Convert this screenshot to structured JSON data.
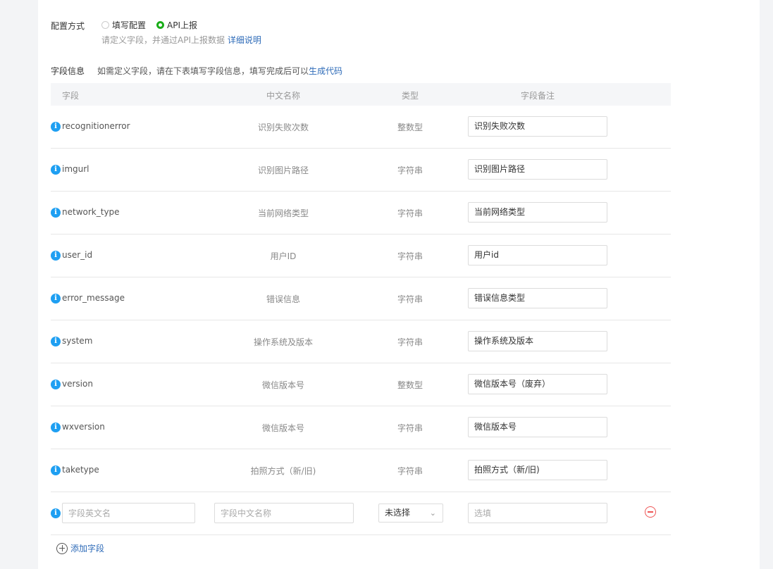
{
  "config": {
    "label": "配置方式",
    "options": [
      {
        "label": "填写配置",
        "checked": false
      },
      {
        "label": "API上报",
        "checked": true
      }
    ],
    "hint": "请定义字段，并通过API上报数据",
    "hint_link": "详细说明"
  },
  "fields": {
    "label": "字段信息",
    "hint": "如需定义字段，请在下表填写字段信息，填写完成后可以",
    "hint_link": "生成代码",
    "headers": [
      "字段",
      "中文名称",
      "类型",
      "字段备注"
    ],
    "rows": [
      {
        "key": "recognitionerror",
        "name": "识别失败次数",
        "type": "整数型",
        "note": "识别失败次数"
      },
      {
        "key": "imgurl",
        "name": "识别图片路径",
        "type": "字符串",
        "note": "识别图片路径"
      },
      {
        "key": "network_type",
        "name": "当前网络类型",
        "type": "字符串",
        "note": "当前网络类型"
      },
      {
        "key": "user_id",
        "name": "用户ID",
        "type": "字符串",
        "note": "用户id"
      },
      {
        "key": "error_message",
        "name": "错误信息",
        "type": "字符串",
        "note": "错误信息类型"
      },
      {
        "key": "system",
        "name": "操作系统及版本",
        "type": "字符串",
        "note": "操作系统及版本"
      },
      {
        "key": "version",
        "name": "微信版本号",
        "type": "整数型",
        "note": "微信版本号（废弃）"
      },
      {
        "key": "wxversion",
        "name": "微信版本号",
        "type": "字符串",
        "note": "微信版本号"
      },
      {
        "key": "taketype",
        "name": "拍照方式（新/旧)",
        "type": "字符串",
        "note": "拍照方式（新/旧)"
      }
    ],
    "new_row": {
      "key_placeholder": "字段英文名",
      "name_placeholder": "字段中文名称",
      "type_value": "未选择",
      "note_placeholder": "选填"
    },
    "add_label": "添加字段"
  },
  "icons": {
    "info": "info-icon",
    "remove": "minus-circle-icon",
    "add": "plus-circle-icon",
    "dropdown": "chevron-down-icon"
  },
  "colors": {
    "accent": "#1aad19",
    "link": "#2e6bb8",
    "info": "#1e9ff2",
    "danger": "#e55555"
  }
}
